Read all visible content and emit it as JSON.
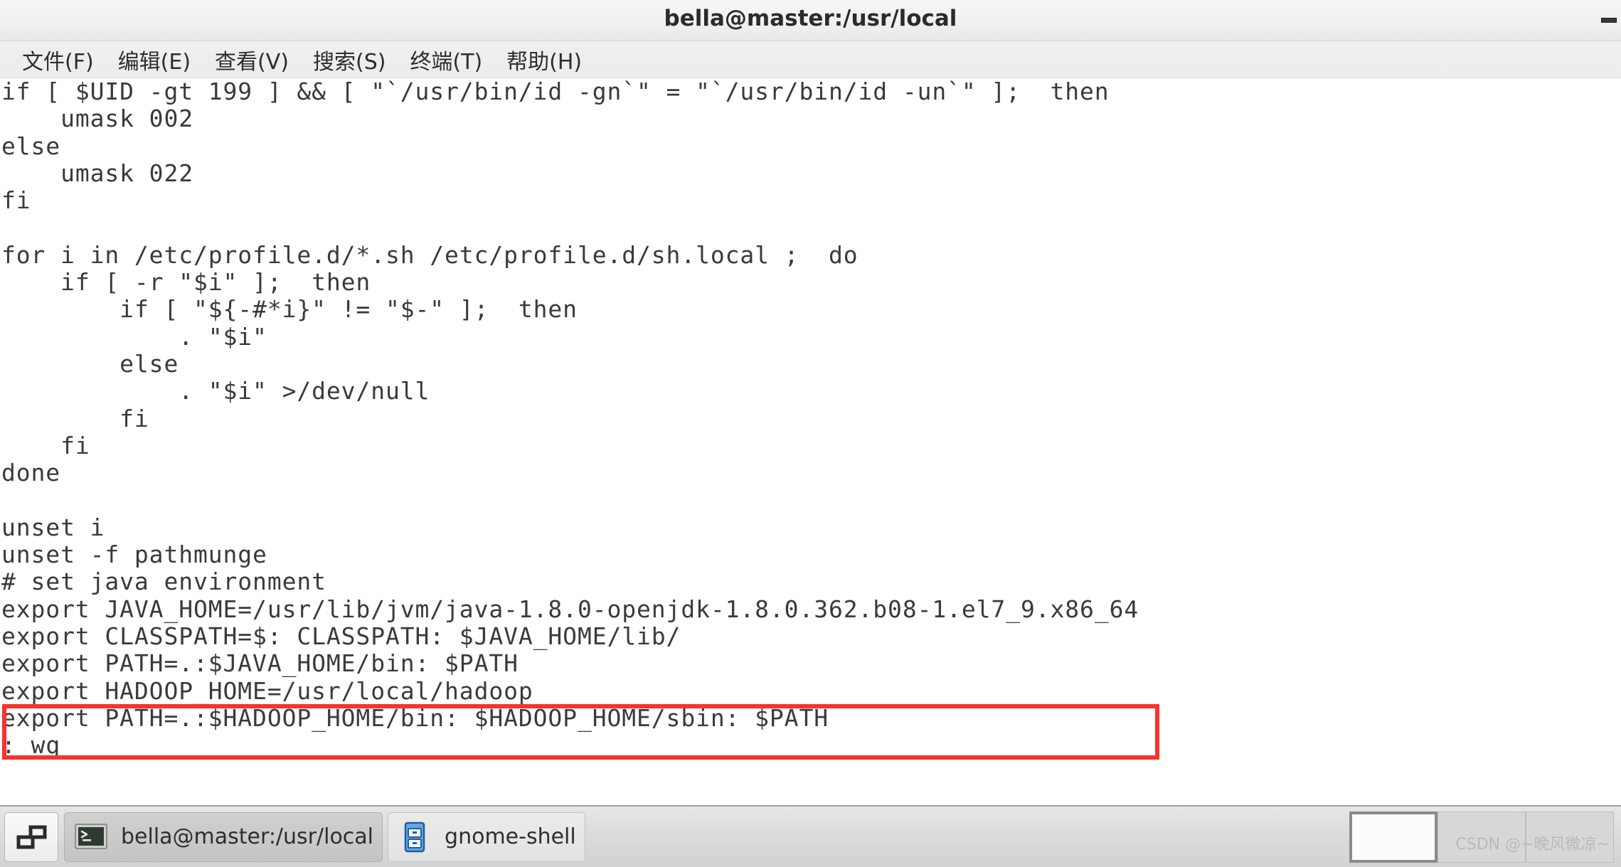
{
  "window": {
    "title": "bella@master:/usr/local",
    "minimize_label": "minimize"
  },
  "menubar": {
    "items": [
      {
        "label": "文件(F)",
        "name": "menu-file"
      },
      {
        "label": "编辑(E)",
        "name": "menu-edit"
      },
      {
        "label": "查看(V)",
        "name": "menu-view"
      },
      {
        "label": "搜索(S)",
        "name": "menu-search"
      },
      {
        "label": "终端(T)",
        "name": "menu-terminal"
      },
      {
        "label": "帮助(H)",
        "name": "menu-help"
      }
    ]
  },
  "terminal": {
    "lines": [
      "if [ $UID -gt 199 ] && [ \"`/usr/bin/id -gn`\" = \"`/usr/bin/id -un`\" ];  then",
      "    umask 002",
      "else",
      "    umask 022",
      "fi",
      "",
      "for i in /etc/profile.d/*.sh /etc/profile.d/sh.local ;  do",
      "    if [ -r \"$i\" ];  then",
      "        if [ \"${-#*i}\" != \"$-\" ];  then",
      "            . \"$i\"",
      "        else",
      "            . \"$i\" >/dev/null",
      "        fi",
      "    fi",
      "done",
      "",
      "unset i",
      "unset -f pathmunge",
      "# set java environment",
      "export JAVA_HOME=/usr/lib/jvm/java-1.8.0-openjdk-1.8.0.362.b08-1.el7_9.x86_64",
      "export CLASSPATH=$: CLASSPATH: $JAVA_HOME/lib/",
      "export PATH=.:$JAVA_HOME/bin: $PATH",
      "export HADOOP_HOME=/usr/local/hadoop",
      "export PATH=.:$HADOOP_HOME/bin: $HADOOP_HOME/sbin: $PATH",
      ": wq"
    ],
    "highlight_color": "#f9322c",
    "highlighted_lines": [
      "export HADOOP_HOME=/usr/local/hadoop",
      "export PATH=.:$HADOOP_HOME/bin: $HADOOP_HOME/sbin: $PATH"
    ]
  },
  "taskbar": {
    "show_desktop_label": "show-desktop",
    "tasks": [
      {
        "label": "bella@master:/usr/local",
        "icon": "terminal-icon",
        "active": true
      },
      {
        "label": "gnome-shell",
        "icon": "file-cabinet-icon",
        "active": false
      }
    ],
    "workspaces": [
      {
        "current": true
      },
      {
        "current": false
      },
      {
        "current": false
      }
    ],
    "watermark": "CSDN @~晚风微凉~"
  }
}
